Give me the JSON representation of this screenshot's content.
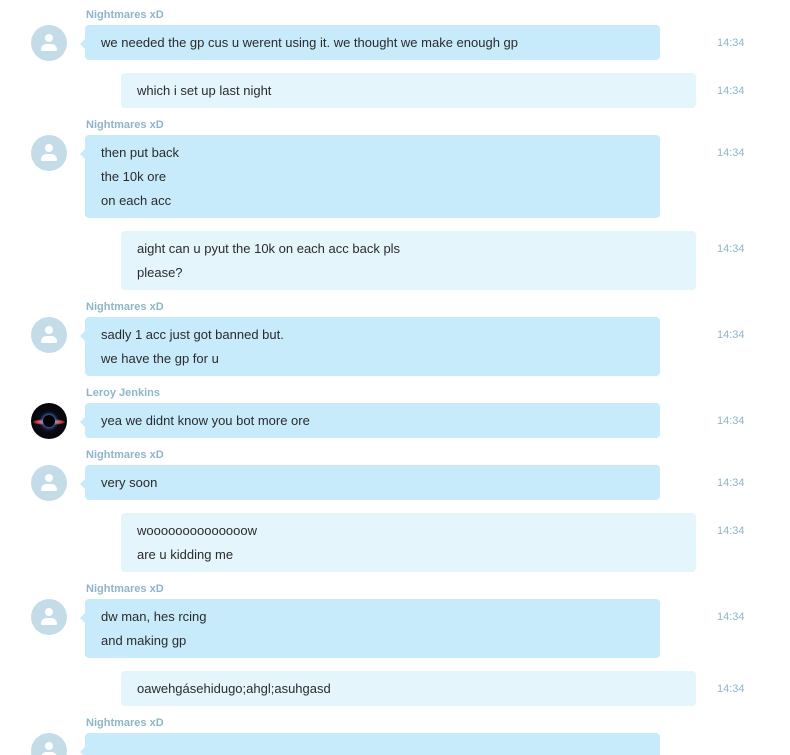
{
  "messages": [
    {
      "sender": "Nightmares xD",
      "direction": "in",
      "avatar": "default-avatar",
      "lines": [
        "we needed the gp cus u werent using it. we thought we make enough gp"
      ],
      "time": "14:34"
    },
    {
      "sender": "",
      "direction": "out",
      "lines": [
        "which i set up last night"
      ],
      "time": "14:34"
    },
    {
      "sender": "Nightmares xD",
      "direction": "in",
      "avatar": "default-avatar",
      "lines": [
        "then put back",
        "the 10k ore",
        "on each acc"
      ],
      "time": "14:34"
    },
    {
      "sender": "",
      "direction": "out",
      "lines": [
        "aight can u pyut the 10k on each acc back pls",
        "please?"
      ],
      "time": "14:34"
    },
    {
      "sender": "Nightmares xD",
      "direction": "in",
      "avatar": "default-avatar",
      "lines": [
        "sadly 1 acc just got banned but.",
        "we have the gp for u"
      ],
      "time": "14:34"
    },
    {
      "sender": "Leroy Jenkins",
      "direction": "in",
      "avatar": "photo-avatar",
      "lines": [
        "yea we didnt know you bot more ore"
      ],
      "time": "14:34"
    },
    {
      "sender": "Nightmares xD",
      "direction": "in",
      "avatar": "default-avatar",
      "lines": [
        "very soon"
      ],
      "time": "14:34"
    },
    {
      "sender": "",
      "direction": "out",
      "lines": [
        "woooooooooooooow",
        "are u kidding me"
      ],
      "time": "14:34"
    },
    {
      "sender": "Nightmares xD",
      "direction": "in",
      "avatar": "default-avatar",
      "lines": [
        "dw man, hes rcing",
        "and making gp"
      ],
      "time": "14:34"
    },
    {
      "sender": "",
      "direction": "out",
      "lines": [
        "oawehgásehidugo;ahgl;asuhgasd"
      ],
      "time": "14:34"
    },
    {
      "sender": "Nightmares xD",
      "direction": "in",
      "avatar": "default-avatar",
      "lines": [],
      "time": ""
    }
  ],
  "colors": {
    "incoming_bubble": "#c7ebfb",
    "outgoing_bubble": "#e4f5fc",
    "meta_text": "#8fb5c8",
    "message_text": "#2b2b2b"
  }
}
